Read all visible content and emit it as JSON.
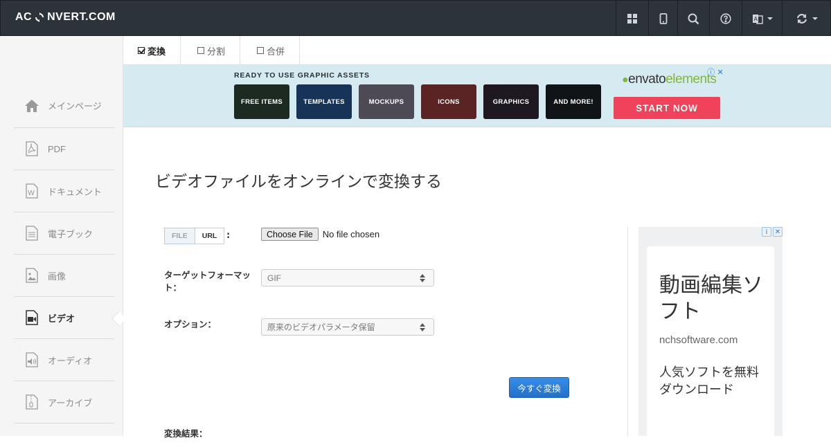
{
  "navbar": {
    "brand_left": "AC",
    "brand_right": "NVERT.COM",
    "buttons": [
      "grid-icon",
      "tablet-icon",
      "search-icon",
      "help-icon",
      "language-icon",
      "refresh-icon"
    ]
  },
  "sidebar": {
    "items": [
      {
        "label": "メインページ",
        "icon": "home-icon"
      },
      {
        "label": "PDF",
        "icon": "pdf-icon"
      },
      {
        "label": "ドキュメント",
        "icon": "word-icon"
      },
      {
        "label": "電子ブック",
        "icon": "ebook-icon"
      },
      {
        "label": "画像",
        "icon": "image-icon"
      },
      {
        "label": "ビデオ",
        "icon": "video-icon",
        "active": true
      },
      {
        "label": "オーディオ",
        "icon": "audio-icon"
      },
      {
        "label": "アーカイブ",
        "icon": "archive-icon"
      }
    ]
  },
  "tabs": [
    {
      "label": "変換",
      "active": true
    },
    {
      "label": "分割",
      "active": false
    },
    {
      "label": "合併",
      "active": false
    }
  ],
  "ad_banner": {
    "title": "READY TO USE GRAPHIC ASSETS",
    "tiles": [
      {
        "label": "FREE ITEMS",
        "color": "#1d2a22"
      },
      {
        "label": "TEMPLATES",
        "color": "#173457"
      },
      {
        "label": "MOCKUPS",
        "color": "#4d4a55"
      },
      {
        "label": "ICONS",
        "color": "#5a2424"
      },
      {
        "label": "GRAPHICS",
        "color": "#1e1820"
      },
      {
        "label": "AND MORE!",
        "color": "#111417"
      }
    ],
    "brand": "envato",
    "brand_suffix": "elements",
    "cta": "START NOW"
  },
  "main": {
    "title": "ビデオファイルをオンラインで変換する",
    "source_toggle": {
      "file": "FILE",
      "url": "URL",
      "colon": ":"
    },
    "choose_file": "Choose File",
    "no_file": "No file chosen",
    "target_label": "ターゲットフォーマット：",
    "target_value": "GIF",
    "options_label": "オプション：",
    "options_value": "原来のビデオパラメータ保留",
    "convert_button": "今すぐ変換",
    "result_label": "変換結果："
  },
  "side_ad": {
    "headline": "動画編集ソフト",
    "domain": "nchsoftware.com",
    "sub": "人気ソフトを無料ダウンロード"
  }
}
